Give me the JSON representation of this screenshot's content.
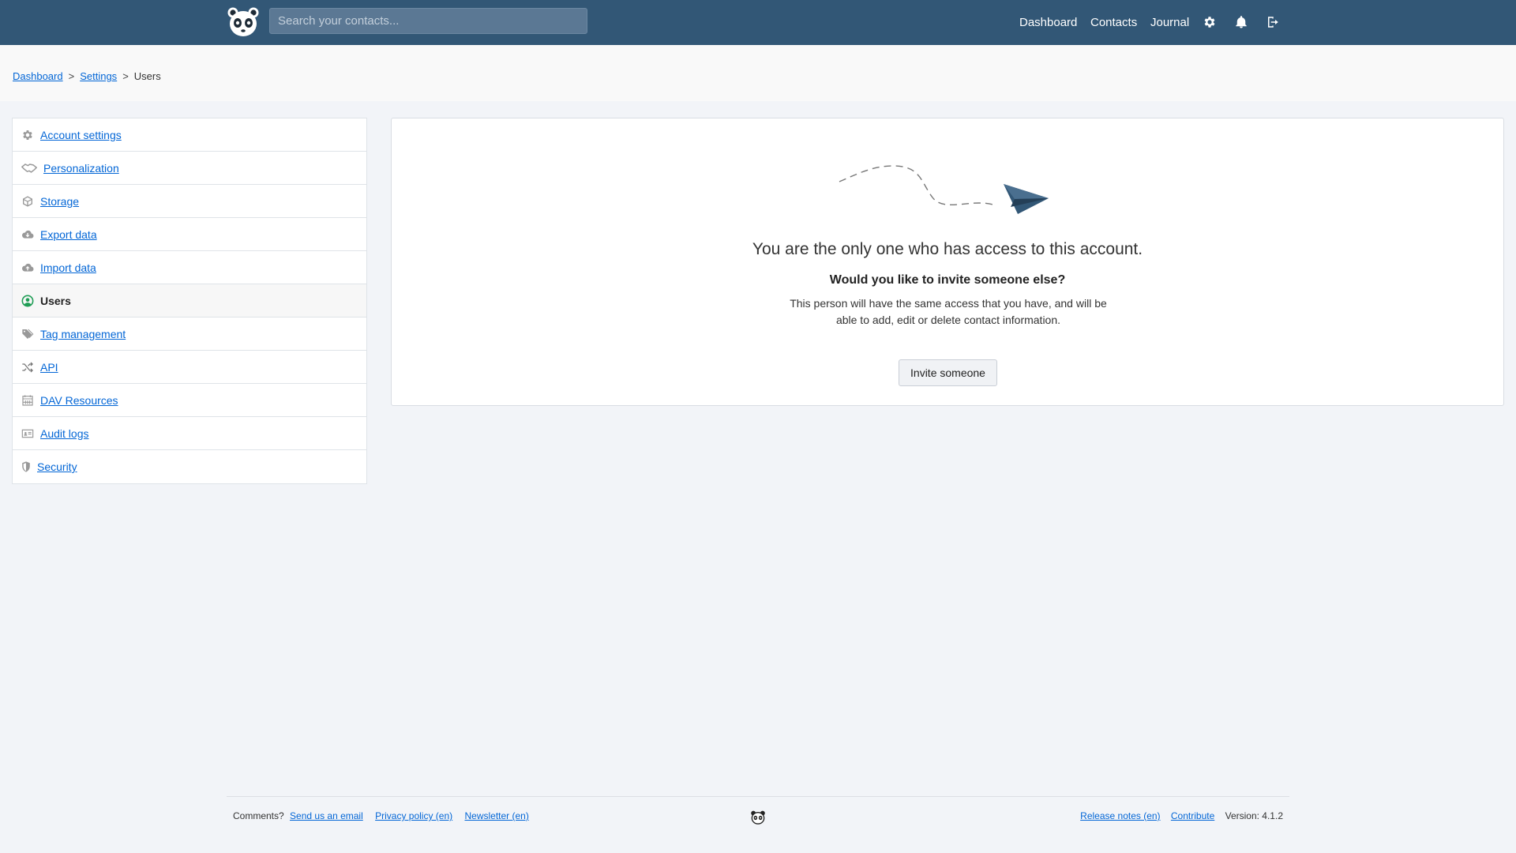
{
  "header": {
    "search_placeholder": "Search your contacts...",
    "nav": [
      "Dashboard",
      "Contacts",
      "Journal"
    ],
    "icons": [
      "gear-icon",
      "bell-icon",
      "logout-icon"
    ],
    "brand_color": "#325776"
  },
  "breadcrumb": {
    "items": [
      "Dashboard",
      "Settings"
    ],
    "current": "Users",
    "separator": ">"
  },
  "sidebar": {
    "items": [
      {
        "label": "Account settings",
        "icon": "gear-icon"
      },
      {
        "label": "Personalization",
        "icon": "handshake-icon"
      },
      {
        "label": "Storage",
        "icon": "box-icon"
      },
      {
        "label": "Export data",
        "icon": "cloud-download-icon"
      },
      {
        "label": "Import data",
        "icon": "cloud-upload-icon"
      },
      {
        "label": "Users",
        "icon": "user-circle-icon",
        "active": true
      },
      {
        "label": "Tag management",
        "icon": "tags-icon"
      },
      {
        "label": "API",
        "icon": "shuffle-icon"
      },
      {
        "label": "DAV Resources",
        "icon": "calendar-icon"
      },
      {
        "label": "Audit logs",
        "icon": "id-card-icon"
      },
      {
        "label": "Security",
        "icon": "shield-icon"
      }
    ],
    "active_color": "#1f9d55"
  },
  "main": {
    "headline": "You are the only one who has access to this account.",
    "subheadline": "Would you like to invite someone else?",
    "description": "This person will have the same access that you have, and will be able to add, edit or delete contact information.",
    "invite_button": "Invite someone"
  },
  "footer": {
    "comments_label": "Comments?",
    "links_left": [
      "Send us an email",
      "Privacy policy (en)",
      "Newsletter (en)"
    ],
    "links_right": [
      "Release notes (en)",
      "Contribute"
    ],
    "version": "Version: 4.1.2"
  }
}
